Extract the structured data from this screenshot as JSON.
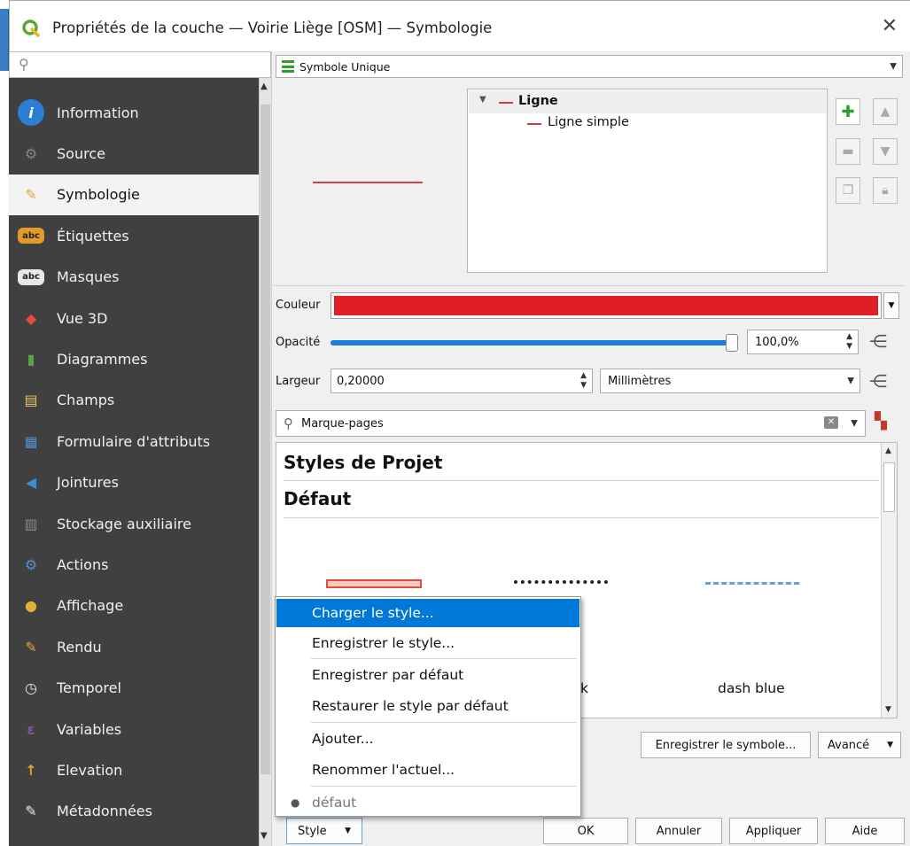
{
  "window": {
    "title": "Propriétés de la couche — Voirie Liège [OSM] — Symbologie",
    "close_glyph": "✕"
  },
  "sidebar": {
    "search_placeholder": "",
    "items": [
      {
        "label": "Information",
        "icon": "info-icon",
        "color": "#2a7fd4",
        "glyph": "i",
        "active": false
      },
      {
        "label": "Source",
        "icon": "source-icon",
        "color": "#7a8a99",
        "glyph": "⚙",
        "active": false
      },
      {
        "label": "Symbologie",
        "icon": "paintbrush-icon",
        "color": "#e6a23c",
        "glyph": "✎",
        "active": true
      },
      {
        "label": "Étiquettes",
        "icon": "labels-icon",
        "color": "#e39a2b",
        "glyph": "abc",
        "active": false
      },
      {
        "label": "Masques",
        "icon": "masks-icon",
        "color": "#e8e8e8",
        "glyph": "abc",
        "active": false
      },
      {
        "label": "Vue 3D",
        "icon": "cube-3d-icon",
        "color": "#e84a3c",
        "glyph": "◆",
        "active": false
      },
      {
        "label": "Diagrammes",
        "icon": "diagrams-icon",
        "color": "#5aa34a",
        "glyph": "▮",
        "active": false
      },
      {
        "label": "Champs",
        "icon": "fields-icon",
        "color": "#f0c05a",
        "glyph": "▤",
        "active": false
      },
      {
        "label": "Formulaire d'attributs",
        "icon": "attribute-form-icon",
        "color": "#4f8fd0",
        "glyph": "▦",
        "active": false
      },
      {
        "label": "Jointures",
        "icon": "joins-icon",
        "color": "#3a8fd0",
        "glyph": "◀",
        "active": false
      },
      {
        "label": "Stockage auxiliaire",
        "icon": "aux-storage-icon",
        "color": "#8a8a8a",
        "glyph": "▥",
        "active": false
      },
      {
        "label": "Actions",
        "icon": "actions-icon",
        "color": "#5a8fd0",
        "glyph": "⚙",
        "active": false
      },
      {
        "label": "Affichage",
        "icon": "display-icon",
        "color": "#e8b030",
        "glyph": "●",
        "active": false
      },
      {
        "label": "Rendu",
        "icon": "rendering-icon",
        "color": "#e6a23c",
        "glyph": "✎",
        "active": false
      },
      {
        "label": "Temporel",
        "icon": "clock-icon",
        "color": "#e8e8e8",
        "glyph": "◷",
        "active": false
      },
      {
        "label": "Variables",
        "icon": "variables-icon",
        "color": "#7a5a9a",
        "glyph": "ε",
        "active": false
      },
      {
        "label": "Elevation",
        "icon": "elevation-icon",
        "color": "#e8a020",
        "glyph": "↑",
        "active": false
      },
      {
        "label": "Métadonnées",
        "icon": "metadata-icon",
        "color": "#e8e8e8",
        "glyph": "✎",
        "active": false
      }
    ]
  },
  "renderer": {
    "selected": "Symbole Unique"
  },
  "symbol_tree": {
    "root": "Ligne",
    "child": "Ligne simple",
    "line_color": "#d23a3a"
  },
  "props": {
    "color_label": "Couleur",
    "color_value": "#e01e26",
    "opacity_label": "Opacité",
    "opacity_value": "100,0%",
    "opacity_fraction": 1.0,
    "width_label": "Largeur",
    "width_value": "0,20000",
    "unit_value": "Millimètres"
  },
  "library": {
    "search_value": "Marque-pages",
    "group1": "Styles de Projet",
    "group2": "Défaut",
    "symbol_names": [
      "",
      "ack",
      "dash blue"
    ]
  },
  "buttons": {
    "save_symbol": "Enregistrer le symbole...",
    "advanced": "Avancé",
    "style": "Style",
    "ok": "OK",
    "cancel": "Annuler",
    "apply": "Appliquer",
    "help": "Aide"
  },
  "menu": {
    "items": [
      "Charger le style...",
      "Enregistrer le style...",
      "Enregistrer par défaut",
      "Restaurer le style par défaut",
      "Ajouter...",
      "Renommer l'actuel...",
      "défaut"
    ]
  }
}
